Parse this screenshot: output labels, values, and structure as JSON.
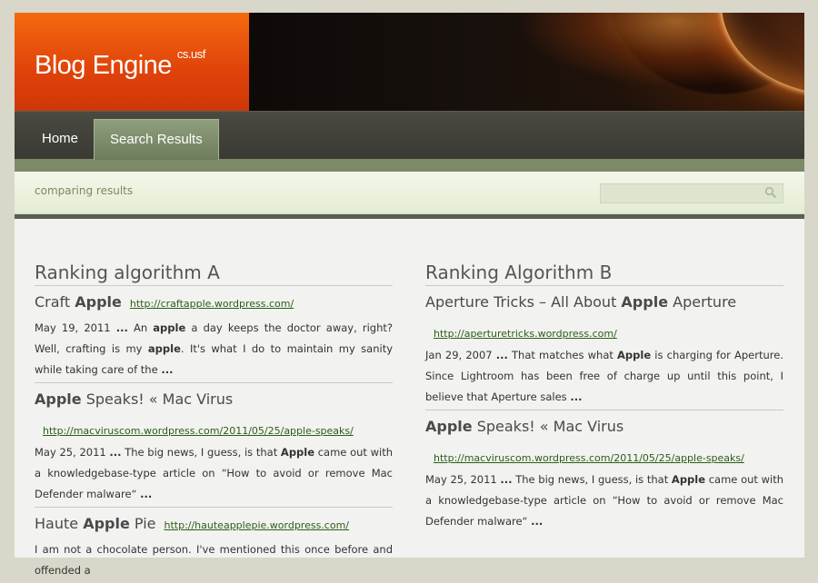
{
  "site": {
    "title": "Blog Engine",
    "superscript": "cs.usf"
  },
  "nav": {
    "items": [
      {
        "label": "Home"
      },
      {
        "label": "Search Results"
      }
    ]
  },
  "subbar": {
    "text": "comparing results",
    "search_placeholder": ""
  },
  "column_a": {
    "heading": "Ranking algorithm A",
    "results": [
      {
        "title_parts": [
          "Craft ",
          "Apple"
        ],
        "url": "http://craftapple.wordpress.com/",
        "snippet_parts": [
          "May 19, 2011 ",
          "...",
          " An ",
          "apple",
          " a day keeps the doctor away, right? Well, crafting is my ",
          "apple",
          ". It's what I do to maintain my sanity while taking care of the ",
          "..."
        ]
      },
      {
        "title_parts": [
          "Apple",
          " Speaks! « Mac Virus"
        ],
        "url": "http://macviruscom.wordpress.com/2011/05/25/apple-speaks/",
        "snippet_parts": [
          "May 25, 2011 ",
          "...",
          " The big news, I guess, is that ",
          "Apple",
          " came out with a knowledgebase-type article on “How to avoid or remove Mac Defender malware“ ",
          "..."
        ]
      },
      {
        "title_parts": [
          "Haute ",
          "Apple",
          " Pie"
        ],
        "url": "http://hauteapplepie.wordpress.com/",
        "snippet_parts": [
          "I am not a chocolate person. I've mentioned this once before and offended a",
          "",
          "",
          "",
          "",
          "",
          "",
          ""
        ]
      }
    ]
  },
  "column_b": {
    "heading": "Ranking Algorithm B",
    "results": [
      {
        "title_parts": [
          "Aperture Tricks – All About ",
          "Apple",
          " Aperture"
        ],
        "url": "http://aperturetricks.wordpress.com/",
        "snippet_parts": [
          "Jan 29, 2007 ",
          "...",
          " That matches what ",
          "Apple",
          " is charging for Aperture. Since Lightroom has been free of charge up until this point, I believe that Aperture sales ",
          "..."
        ]
      },
      {
        "title_parts": [
          "Apple",
          " Speaks! « Mac Virus"
        ],
        "url": "http://macviruscom.wordpress.com/2011/05/25/apple-speaks/",
        "snippet_parts": [
          "May 25, 2011 ",
          "...",
          " The big news, I guess, is that ",
          "Apple",
          " came out with a knowledgebase-type article on “How to avoid or remove Mac Defender malware“ ",
          "..."
        ]
      }
    ]
  },
  "colors": {
    "logo_orange": "#e0420a",
    "nav_active": "#7d8c69",
    "link_green": "#2b5f14"
  },
  "icons": {
    "search": "search-icon"
  }
}
